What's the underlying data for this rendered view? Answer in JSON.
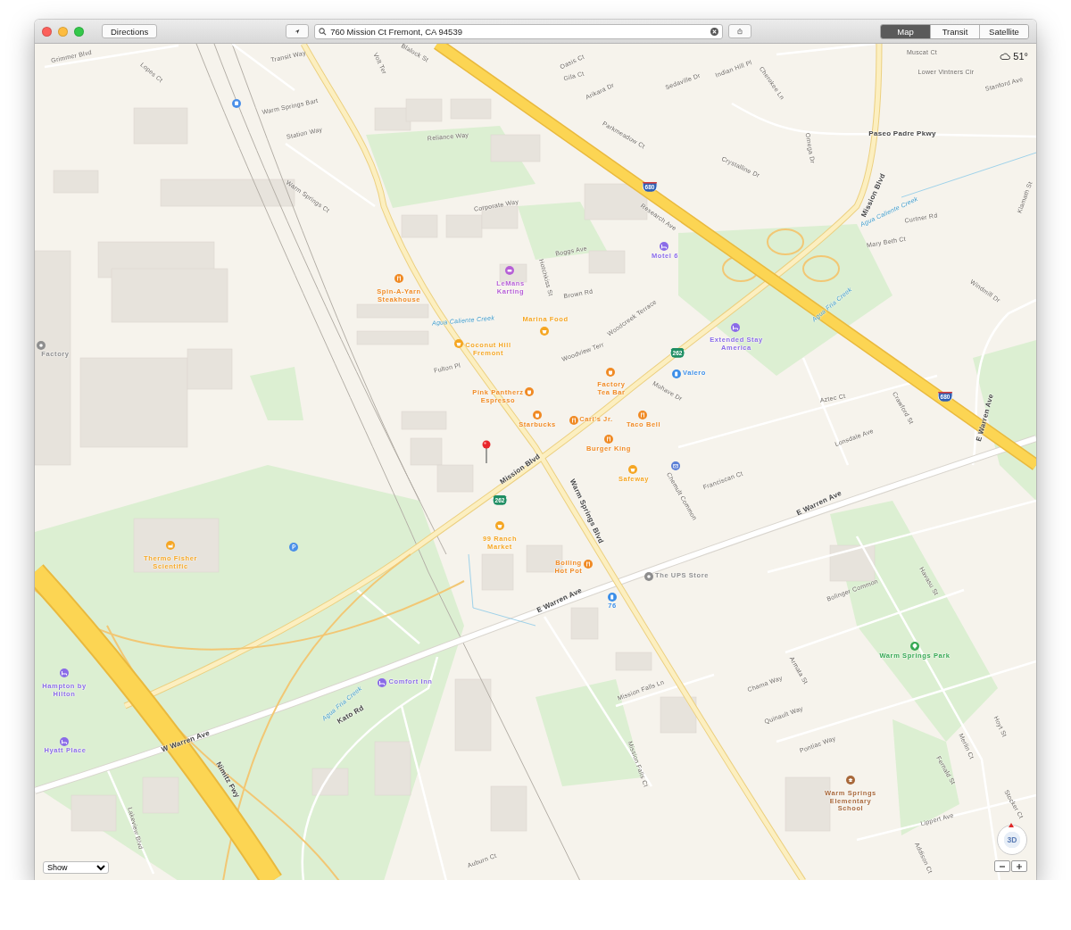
{
  "toolbar": {
    "directions": "Directions",
    "search": {
      "value": "760 Mission Ct Fremont, CA 94539"
    },
    "view_modes": [
      {
        "label": "Map",
        "selected": true
      },
      {
        "label": "Transit",
        "selected": false
      },
      {
        "label": "Satellite",
        "selected": false
      }
    ]
  },
  "map": {
    "weather": {
      "temperature": "51°"
    },
    "streets": [
      {
        "name": "Grimmer Blvd",
        "kind": "street"
      },
      {
        "name": "Lopes Ct",
        "kind": "street"
      },
      {
        "name": "Transit Way",
        "kind": "street"
      },
      {
        "name": "Warm Springs Bart",
        "kind": "street"
      },
      {
        "name": "Station Way",
        "kind": "street"
      },
      {
        "name": "Warm Springs Ct",
        "kind": "street"
      },
      {
        "name": "Volt Ter",
        "kind": "street"
      },
      {
        "name": "Blalock St",
        "kind": "street"
      },
      {
        "name": "Reliance Way",
        "kind": "street"
      },
      {
        "name": "Corporate Way",
        "kind": "street"
      },
      {
        "name": "Research Ave",
        "kind": "street"
      },
      {
        "name": "Oasis Ct",
        "kind": "street"
      },
      {
        "name": "Gila Ct",
        "kind": "street"
      },
      {
        "name": "Arikara Dr",
        "kind": "street"
      },
      {
        "name": "Sedaville Dr",
        "kind": "street"
      },
      {
        "name": "Parkmeadow Ct",
        "kind": "street"
      },
      {
        "name": "Boggs Ave",
        "kind": "street"
      },
      {
        "name": "Hotchkiss St",
        "kind": "street"
      },
      {
        "name": "Brown Rd",
        "kind": "street"
      },
      {
        "name": "Agua Caliente Creek",
        "kind": "creek"
      },
      {
        "name": "Woodcreek Terrace",
        "kind": "street"
      },
      {
        "name": "Woodview Terr",
        "kind": "street"
      },
      {
        "name": "Fulton Pl",
        "kind": "street"
      },
      {
        "name": "Mohave Dr",
        "kind": "street"
      },
      {
        "name": "Indian Hill Pl",
        "kind": "street"
      },
      {
        "name": "Cherokee Ln",
        "kind": "street"
      },
      {
        "name": "Muscat Ct",
        "kind": "street"
      },
      {
        "name": "Lower Vintners Cir",
        "kind": "street"
      },
      {
        "name": "Stanford Ave",
        "kind": "street"
      },
      {
        "name": "Paseo Padre Pkwy",
        "kind": "major"
      },
      {
        "name": "Omega Dr",
        "kind": "street"
      },
      {
        "name": "Crystalline Dr",
        "kind": "street"
      },
      {
        "name": "Mission Blvd",
        "kind": "major"
      },
      {
        "name": "Agua Caliente Creek",
        "kind": "creek"
      },
      {
        "name": "Curtner Rd",
        "kind": "street"
      },
      {
        "name": "Mary Beth Ct",
        "kind": "street"
      },
      {
        "name": "Klamath St",
        "kind": "street"
      },
      {
        "name": "Windmill Dr",
        "kind": "street"
      },
      {
        "name": "Agua Fria Creek",
        "kind": "creek"
      },
      {
        "name": "Aztec Ct",
        "kind": "street"
      },
      {
        "name": "Crawford St",
        "kind": "street"
      },
      {
        "name": "Lonsdale Ave",
        "kind": "street"
      },
      {
        "name": "E Warren Ave",
        "kind": "major"
      },
      {
        "name": "Mission Blvd",
        "kind": "major"
      },
      {
        "name": "Warm Springs Blvd",
        "kind": "major"
      },
      {
        "name": "Chemult Common",
        "kind": "street"
      },
      {
        "name": "Franciscan Ct",
        "kind": "street"
      },
      {
        "name": "E Warren Ave",
        "kind": "major"
      },
      {
        "name": "Bolinger Common",
        "kind": "street"
      },
      {
        "name": "Havasu St",
        "kind": "street"
      },
      {
        "name": "E Warren Ave",
        "kind": "major"
      },
      {
        "name": "Mission Falls Ln",
        "kind": "street"
      },
      {
        "name": "Mission Falls Ct",
        "kind": "street"
      },
      {
        "name": "Armata St",
        "kind": "street"
      },
      {
        "name": "Chama Way",
        "kind": "street"
      },
      {
        "name": "Quinault Way",
        "kind": "street"
      },
      {
        "name": "Pontiac Way",
        "kind": "street"
      },
      {
        "name": "Merlin Ct",
        "kind": "street"
      },
      {
        "name": "Hoyt St",
        "kind": "street"
      },
      {
        "name": "Fernald St",
        "kind": "street"
      },
      {
        "name": "Stocker Ct",
        "kind": "street"
      },
      {
        "name": "Lippert Ave",
        "kind": "street"
      },
      {
        "name": "Addison Ct",
        "kind": "street"
      },
      {
        "name": "Kato Rd",
        "kind": "major"
      },
      {
        "name": "Agua Fria Creek",
        "kind": "creek"
      },
      {
        "name": "W Warren Ave",
        "kind": "major"
      },
      {
        "name": "Nimitz Fwy",
        "kind": "major"
      },
      {
        "name": "Lakeview Blvd",
        "kind": "street"
      },
      {
        "name": "Auburn Ct",
        "kind": "street"
      }
    ],
    "shields": [
      {
        "number": "680",
        "kind": "interstate"
      },
      {
        "number": "680",
        "kind": "interstate"
      },
      {
        "number": "262",
        "kind": "state"
      },
      {
        "number": "262",
        "kind": "state"
      }
    ],
    "places": [
      {
        "name": "Factory",
        "kind": "generic",
        "color": "#8e8e8e"
      },
      {
        "kind": "transit",
        "color": "#4a8fe8"
      },
      {
        "name": "Spin-A-Yarn Steakhouse",
        "kind": "food",
        "color": "#f08a24"
      },
      {
        "name": "LeMans Karting",
        "kind": "leisure",
        "color": "#b65fd6"
      },
      {
        "name": "Motel 6",
        "kind": "hotel",
        "color": "#8a6be8"
      },
      {
        "name": "Marina Food",
        "kind": "shop",
        "color": "#f5a623"
      },
      {
        "name": "Coconut Hill Fremont",
        "kind": "shop",
        "color": "#f5a623"
      },
      {
        "name": "Extended Stay America",
        "kind": "hotel",
        "color": "#8a6be8"
      },
      {
        "name": "Valero",
        "kind": "fuel",
        "color": "#3b8ee8"
      },
      {
        "name": "Factory Tea Bar",
        "kind": "coffee",
        "color": "#f08a24"
      },
      {
        "name": "Pink Pantherz Espresso",
        "kind": "coffee",
        "color": "#f08a24"
      },
      {
        "name": "Starbucks",
        "kind": "coffee",
        "color": "#f08a24"
      },
      {
        "name": "Carl's Jr.",
        "kind": "food",
        "color": "#f08a24"
      },
      {
        "name": "Taco Bell",
        "kind": "food",
        "color": "#f08a24"
      },
      {
        "name": "Burger King",
        "kind": "food",
        "color": "#f08a24"
      },
      {
        "name": "Safeway",
        "kind": "shop",
        "color": "#f5a623"
      },
      {
        "kind": "post",
        "color": "#5b7fd6"
      },
      {
        "name": "99 Ranch Market",
        "kind": "shop",
        "color": "#f5a623"
      },
      {
        "name": "Boiling Hot Pot",
        "kind": "food",
        "color": "#f08a24"
      },
      {
        "name": "The UPS Store",
        "kind": "generic",
        "color": "#8e8e8e"
      },
      {
        "name": "76",
        "kind": "fuel",
        "color": "#3b8ee8"
      },
      {
        "name": "Thermo Fisher Scientific",
        "kind": "industry",
        "color": "#f5a623"
      },
      {
        "kind": "parking",
        "color": "#4a8fe8"
      },
      {
        "name": "Hampton by Hilton",
        "kind": "hotel",
        "color": "#8a6be8"
      },
      {
        "name": "Hyatt Place",
        "kind": "hotel",
        "color": "#8a6be8"
      },
      {
        "name": "Comfort Inn",
        "kind": "hotel",
        "color": "#8a6be8"
      },
      {
        "name": "Warm Springs Park",
        "kind": "park",
        "color": "#35a852"
      },
      {
        "name": "Warm Springs Elementary School",
        "kind": "school",
        "color": "#a8683a"
      }
    ]
  },
  "controls": {
    "show": "Show",
    "compass": "3D"
  }
}
